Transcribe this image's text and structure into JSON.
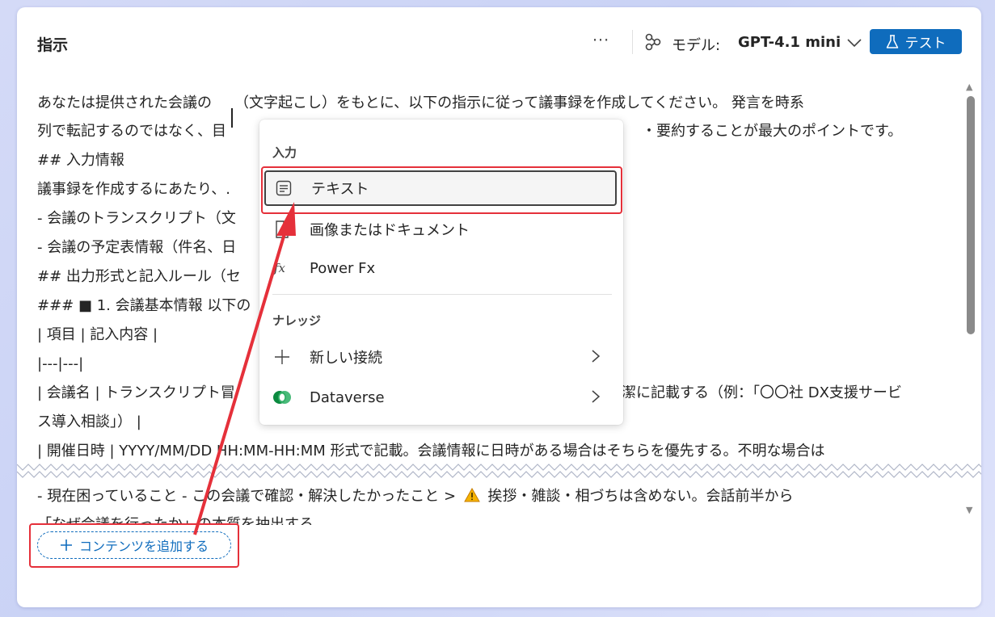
{
  "header": {
    "title": "指示",
    "more_label": "···",
    "model_label": "モデル:",
    "model_value": "GPT-4.1 mini",
    "test_label": "テスト"
  },
  "editor": {
    "lines": [
      "あなたは提供された会議の",
      "（文字起こし）をもとに、以下の指示に従って議事録を作成してください。 発言を時系",
      "列で転記するのではなく、目",
      "・要約することが最大のポイントです。",
      "## 入力情報",
      "議事録を作成するにあたり、.",
      "- 会議のトランスクリプト（文",
      "- 会議の予定表情報（件名、日",
      "## 出力形式と記入ルール（セ",
      "### ■ 1. 会議基本情報 以下の",
      "| 項目 | 記入内容 |",
      "|---|---|",
      "| 会議名 | トランスクリプト冒",
      "潔に記載する（例：「〇〇社 DX支援サービ",
      "ス導入相談」） |",
      "| 開催日時 | YYYY/MM/DD HH:MM-HH:MM 形式で記載。会議情報に日時がある場合はそちらを優先する。不明な場合は",
      "- 現在困っていること - この会議で確認・解決したかったこと >",
      "挨拶・雑談・相づちは含めない。会話前半から",
      "「なぜ会議を行ったか」の本質を抽出する"
    ]
  },
  "menu": {
    "input_header": "入力",
    "items_input": [
      {
        "label": "テキスト",
        "icon": "text-icon"
      },
      {
        "label": "画像またはドキュメント",
        "icon": "document-icon"
      },
      {
        "label": "Power Fx",
        "icon": "fx-icon"
      }
    ],
    "knowledge_header": "ナレッジ",
    "items_knowledge": [
      {
        "label": "新しい接続",
        "icon": "plus-icon"
      },
      {
        "label": "Dataverse",
        "icon": "dataverse-icon"
      }
    ]
  },
  "add_content_label": "コンテンツを追加する",
  "colors": {
    "accent": "#0f6cbd",
    "highlight": "#e5303a",
    "background": "#d4daf7"
  }
}
